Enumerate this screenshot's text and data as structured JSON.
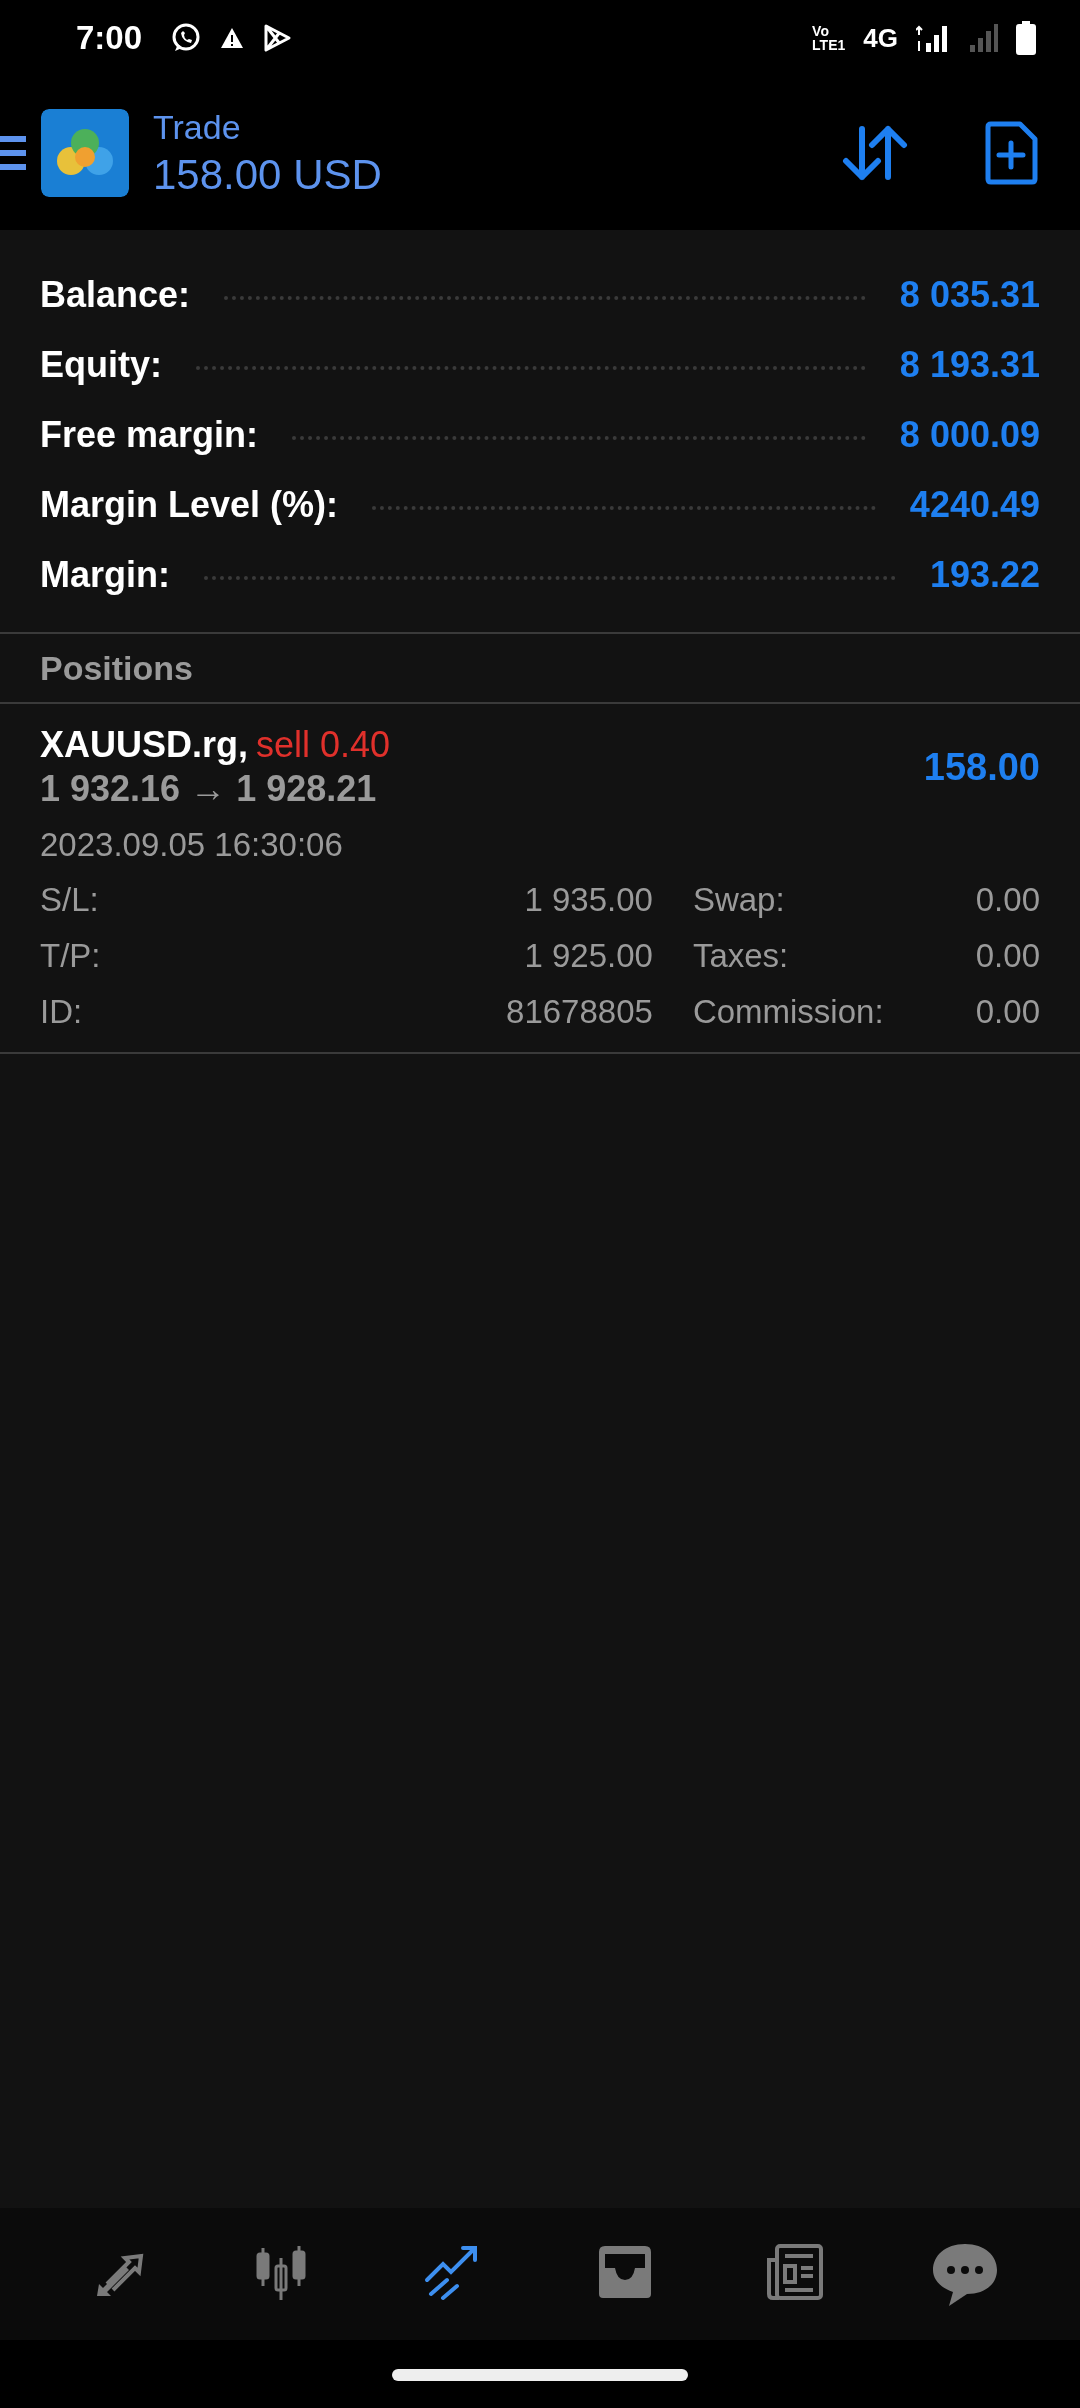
{
  "status_bar": {
    "time": "7:00",
    "volte_top": "Vo",
    "volte_bottom": "LTE1",
    "network": "4G"
  },
  "header": {
    "title": "Trade",
    "subtitle": "158.00 USD"
  },
  "summary": [
    {
      "label": "Balance:",
      "value": "8 035.31"
    },
    {
      "label": "Equity:",
      "value": "8 193.31"
    },
    {
      "label": "Free margin:",
      "value": "8 000.09"
    },
    {
      "label": "Margin Level (%):",
      "value": "4240.49"
    },
    {
      "label": "Margin:",
      "value": "193.22"
    }
  ],
  "positions": {
    "title": "Positions",
    "items": [
      {
        "symbol": "XAUUSD.rg,",
        "side": "sell",
        "volume": "0.40",
        "prices": "1 932.16 → 1 928.21",
        "profit": "158.00",
        "time": "2023.09.05 16:30:06",
        "details": [
          {
            "label": "S/L:",
            "value": "1 935.00"
          },
          {
            "label": "Swap:",
            "value": "0.00"
          },
          {
            "label": "T/P:",
            "value": "1 925.00"
          },
          {
            "label": "Taxes:",
            "value": "0.00"
          },
          {
            "label": "ID:",
            "value": "81678805"
          },
          {
            "label": "Commission:",
            "value": "0.00"
          }
        ]
      }
    ]
  },
  "bottom_nav": [
    {
      "selected": false
    },
    {
      "selected": false
    },
    {
      "selected": true
    },
    {
      "selected": false
    },
    {
      "selected": false
    },
    {
      "selected": false
    }
  ]
}
